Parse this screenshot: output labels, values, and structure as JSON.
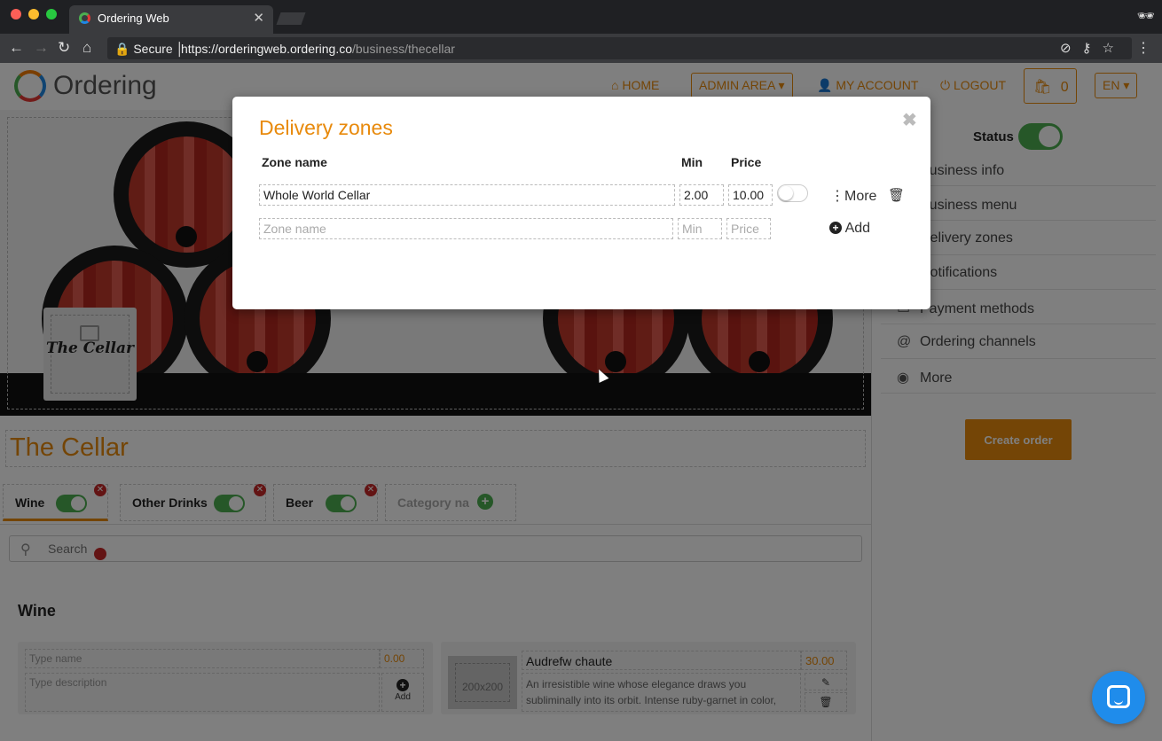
{
  "browser": {
    "tab_title": "Ordering Web",
    "secure_label": "Secure",
    "url_host": "https://orderingweb.ordering.co",
    "url_path": "/business/thecellar"
  },
  "header": {
    "logo_text": "Ordering",
    "home": "HOME",
    "admin_area": "ADMIN AREA",
    "my_account": "MY ACCOUNT",
    "logout": "LOGOUT",
    "cart_count": "0",
    "language": "EN"
  },
  "business": {
    "name": "The Cellar",
    "logo_text": "The Cellar"
  },
  "categories": [
    {
      "label": "Wine",
      "enabled": true
    },
    {
      "label": "Other Drinks",
      "enabled": true
    },
    {
      "label": "Beer",
      "enabled": true
    }
  ],
  "category_new_placeholder": "Category na",
  "search": {
    "placeholder": "Search"
  },
  "section": {
    "title": "Wine"
  },
  "new_product": {
    "name_placeholder": "Type name",
    "price": "0.00",
    "description_placeholder": "Type description",
    "add_label": "Add"
  },
  "product": {
    "image_label": "200x200",
    "name": "Audrefw chaute",
    "price": "30.00",
    "description": "An irresistible wine whose elegance draws you subliminally into its orbit. Intense ruby-garnet in color,"
  },
  "admin_panel": {
    "status_label": "Status",
    "menu": [
      {
        "label": "Business info",
        "icon": "building-icon"
      },
      {
        "label": "Business menu",
        "icon": "menu-icon"
      },
      {
        "label": "Delivery zones",
        "icon": "map-icon"
      },
      {
        "label": "Notifications",
        "icon": "bell-icon"
      },
      {
        "label": "Payment methods",
        "icon": "credit-card-icon"
      },
      {
        "label": "Ordering channels",
        "icon": "at-icon"
      },
      {
        "label": "More",
        "icon": "circle-icon"
      }
    ],
    "create_order": "Create order"
  },
  "modal": {
    "title": "Delivery zones",
    "columns": {
      "zone_name": "Zone name",
      "min": "Min",
      "price": "Price"
    },
    "zone": {
      "name": "Whole World Cellar",
      "min": "2.00",
      "price": "10.00",
      "enabled": false
    },
    "new_zone": {
      "name_placeholder": "Zone name",
      "min_placeholder": "Min",
      "price_placeholder": "Price"
    },
    "more_label": "More",
    "add_label": "Add"
  },
  "colors": {
    "accent": "#e88a0c",
    "toggle_on": "#4caf50",
    "chat": "#1f8ceb"
  }
}
